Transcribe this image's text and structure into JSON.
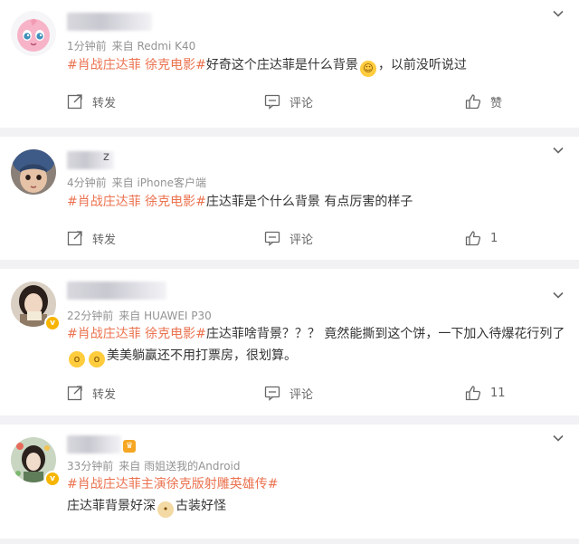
{
  "colors": {
    "topic": "#eb7350",
    "meta": "#939393",
    "text": "#333333",
    "page_bg": "#f2f2f5",
    "badge": "#f7b500"
  },
  "comments": [
    {
      "meta": {
        "time": "1分钟前",
        "source": "来自 Redmi K40"
      },
      "topic": "#肖战庄达菲 徐克电影#",
      "text_before": "好奇这个庄达菲是什么背景",
      "emoji": "grinning-sweat-emoji",
      "text_after": "，以前没听说过",
      "actions": {
        "share": "转发",
        "comment": "评论",
        "like": "赞"
      },
      "verified": false
    },
    {
      "meta": {
        "time": "4分钟前",
        "source": "来自 iPhone客户端"
      },
      "topic": "#肖战庄达菲 徐克电影#",
      "text_before": "庄达菲是个什么背景 有点厉害的样子",
      "actions": {
        "share": "转发",
        "comment": "评论",
        "like": "1"
      },
      "verified": false
    },
    {
      "meta": {
        "time": "22分钟前",
        "source": "来自 HUAWEI P30"
      },
      "topic": "#肖战庄达菲 徐克电影#",
      "text_before": "庄达菲啥背景？？？ 竟然能撕到这个饼，一下加入待爆花行列了",
      "emoji": "astonished-emoji",
      "text_after": "美美躺赢还不用打票房，很划算。",
      "actions": {
        "share": "转发",
        "comment": "评论",
        "like": "11"
      },
      "verified": true
    },
    {
      "meta": {
        "time": "33分钟前",
        "source": "来自 雨姐送我的Android"
      },
      "topic": "#肖战庄达菲主演徐克版射雕英雄传#",
      "text_before": "庄达菲背景好深",
      "emoji": "doge-emoji",
      "text_after": "古装好怪",
      "verified": true
    }
  ]
}
